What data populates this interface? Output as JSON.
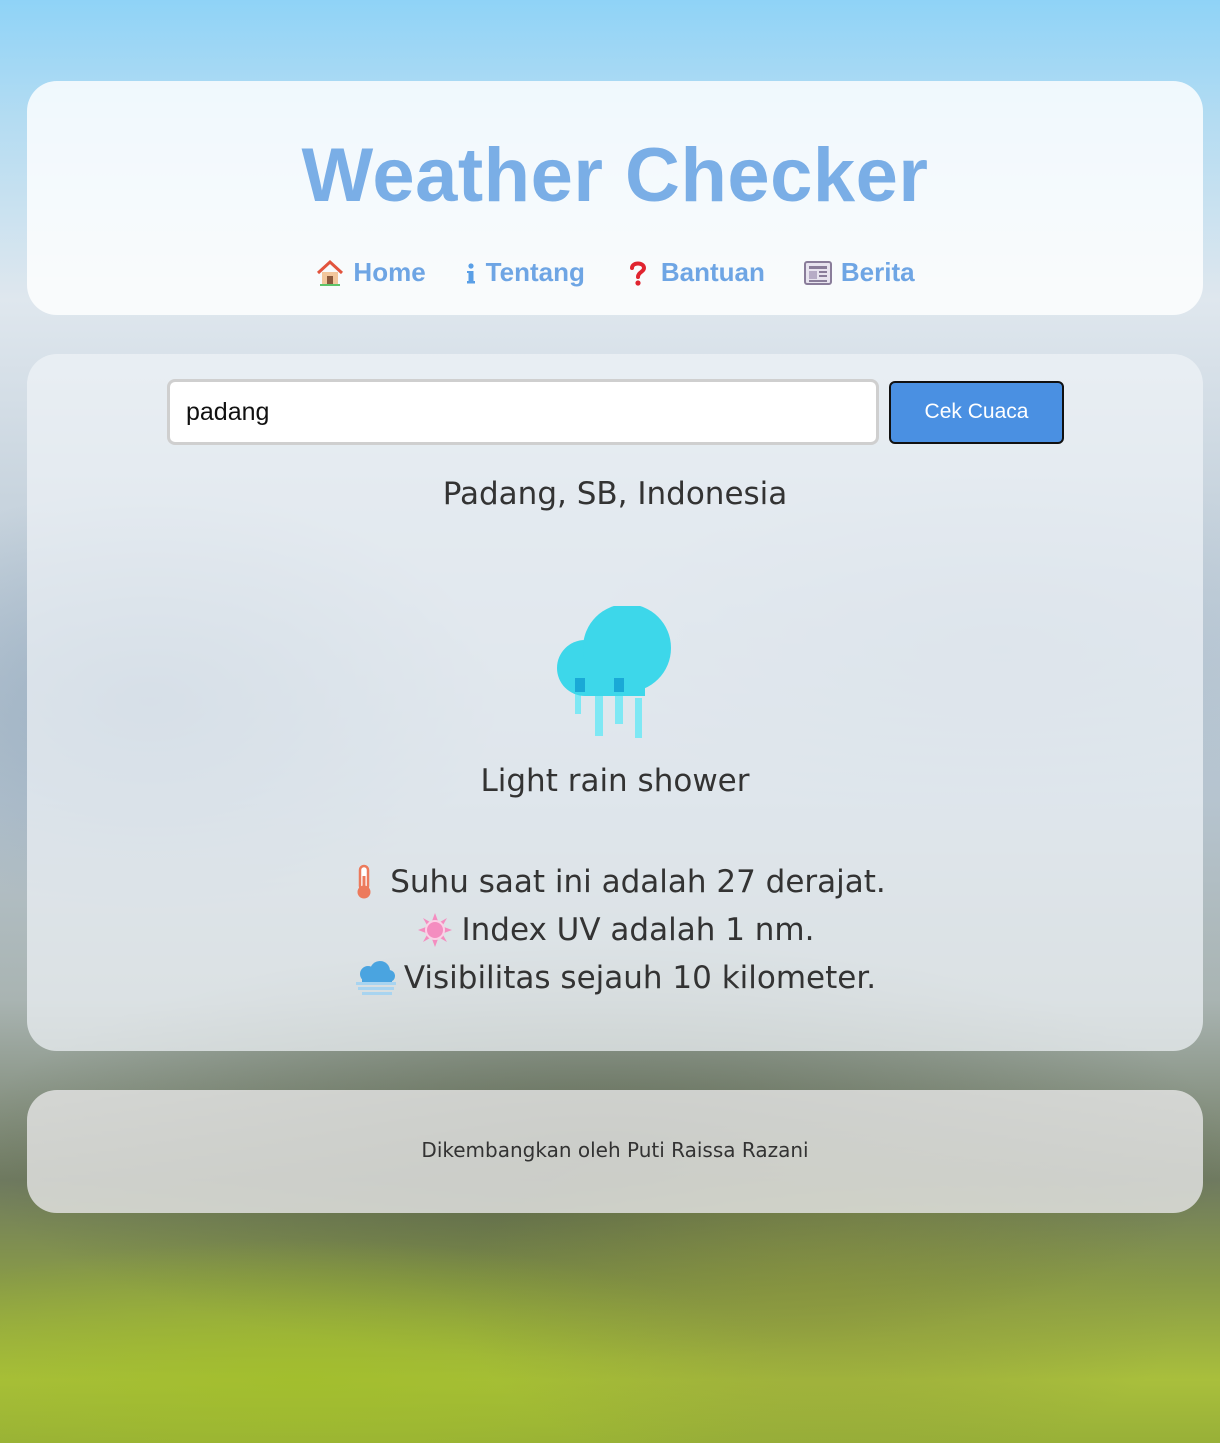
{
  "header": {
    "title": "Weather Checker",
    "nav": [
      {
        "label": "Home",
        "icon": "house-icon"
      },
      {
        "label": "Tentang",
        "icon": "info-icon"
      },
      {
        "label": "Bantuan",
        "icon": "question-icon"
      },
      {
        "label": "Berita",
        "icon": "newspaper-icon"
      }
    ]
  },
  "search": {
    "value": "padang",
    "button_label": "Cek Cuaca"
  },
  "weather": {
    "location": "Padang, SB, Indonesia",
    "icon": "rain-cloud-icon",
    "condition": "Light rain shower",
    "details": [
      {
        "icon": "thermometer-icon",
        "text": "Suhu saat ini adalah 27 derajat."
      },
      {
        "icon": "sun-icon",
        "text": "Index UV adalah 1 nm."
      },
      {
        "icon": "fog-cloud-icon",
        "text": "Visibilitas sejauh 10 kilometer."
      }
    ]
  },
  "footer": {
    "text": "Dikembangkan oleh Puti Raissa Razani"
  },
  "colors": {
    "accent": "#4a90e2",
    "title": "#7aaee6",
    "rain_icon": "#3dd7ea"
  }
}
